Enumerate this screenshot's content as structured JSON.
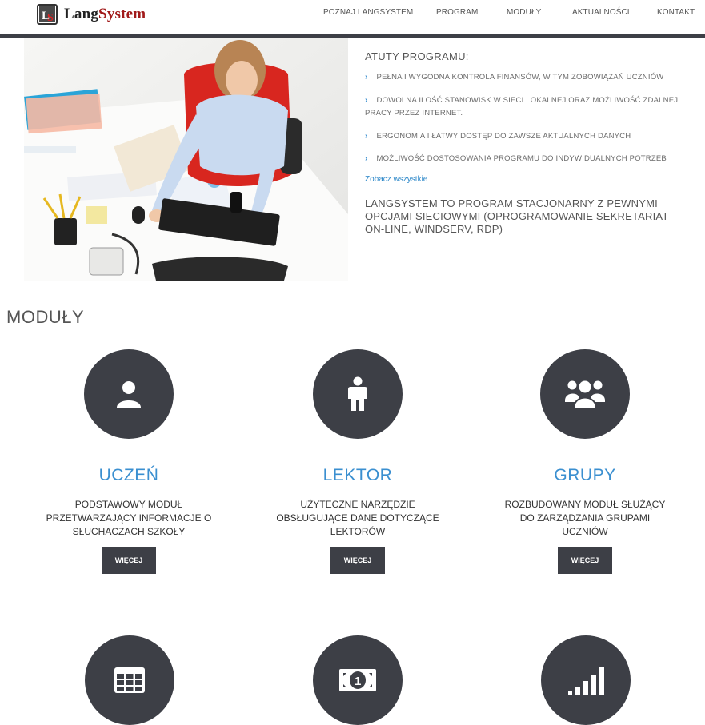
{
  "header": {
    "logo_icon": "ls-logo-icon",
    "logo_text_1": "Lang",
    "logo_text_2": "System",
    "nav": [
      "POZNAJ LANGSYSTEM",
      "PROGRAM",
      "MODUŁY",
      "AKTUALNOŚCI",
      "KONTAKT"
    ]
  },
  "features": {
    "title": "ATUTY PROGRAMU:",
    "items": [
      "PEŁNA I WYGODNA KONTROLA FINANSÓW, W TYM ZOBOWIĄZAŃ UCZNIÓW",
      "DOWOLNA ILOŚĆ STANOWISK W SIECI LOKALNEJ ORAZ MOŻLIWOŚĆ ZDALNEJ PRACY PRZEZ INTERNET.",
      "ERGONOMIA I ŁATWY DOSTĘP DO ZAWSZE AKTUALNYCH DANYCH",
      "MOŻLIWOŚĆ DOSTOSOWANIA PROGRAMU DO INDYWIDUALNYCH POTRZEB"
    ],
    "see_all": "Zobacz wszystkie",
    "blurb": "LANGSYSTEM TO PROGRAM STACJONARNY Z PEWNYMI OPCJAMI SIECIOWYMI (OPROGRAMOWANIE SEKRETARIAT ON-LINE, WINDSERV, RDP)"
  },
  "modules": {
    "title": "MODUŁY",
    "items": [
      {
        "icon": "user-icon",
        "name": "UCZEŃ",
        "desc": "PODSTAWOWY MODUŁ PRZETWARZAJĄCY INFORMACJE O SŁUCHACZACH SZKOŁY",
        "button": "WIĘCEJ"
      },
      {
        "icon": "person-icon",
        "name": "LEKTOR",
        "desc": "UŻYTECZNE NARZĘDZIE OBSŁUGUJĄCE DANE DOTYCZĄCE LEKTORÓW",
        "button": "WIĘCEJ"
      },
      {
        "icon": "group-icon",
        "name": "GRUPY",
        "desc": "ROZBUDOWANY MODUŁ SŁUŻĄCY DO ZARZĄDZANIA GRUPAMI UCZNIÓW",
        "button": "WIĘCEJ"
      }
    ],
    "lower_icons": [
      "table-icon",
      "money-icon",
      "signal-bars-icon"
    ]
  },
  "colors": {
    "accent": "#3a8fd0",
    "dark": "#3d3f46",
    "logo_red": "#a11a1a"
  }
}
